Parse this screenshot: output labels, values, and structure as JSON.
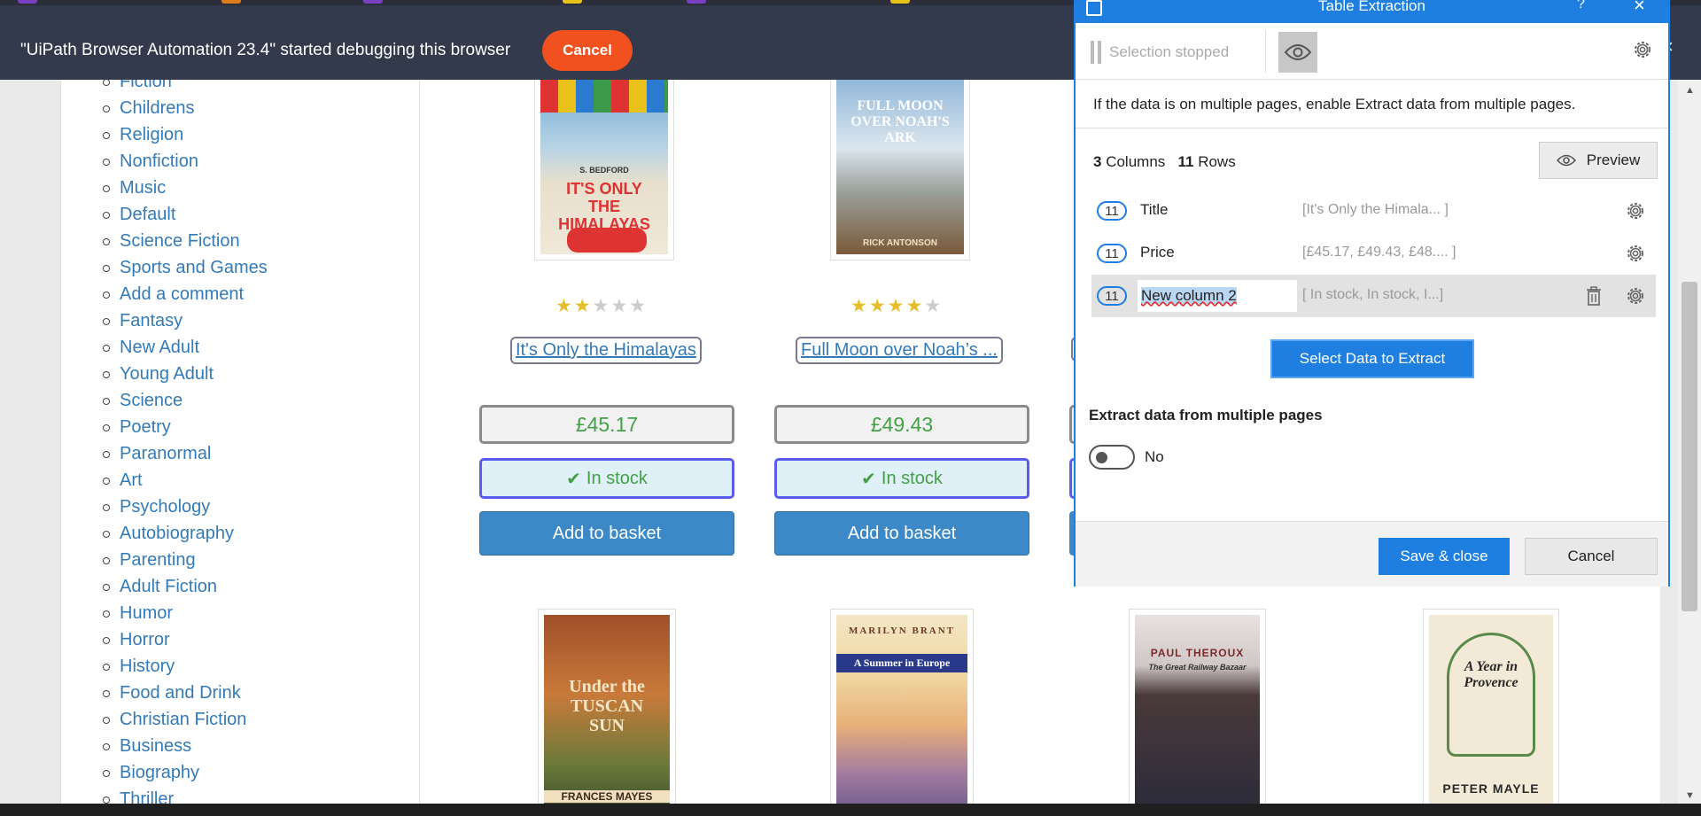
{
  "tabs": {
    "colors": [
      "#7b3fc4",
      "#e07b1a",
      "#7b3fc4",
      "#e8c21a",
      "#7b3fc4",
      "#e8c21a"
    ]
  },
  "debug_bar": {
    "message": "\"UiPath Browser Automation 23.4\" started debugging this browser",
    "cancel_label": "Cancel",
    "close_icon": "×"
  },
  "sidebar": {
    "partial_top": "Fiction",
    "categories": [
      "Childrens",
      "Religion",
      "Nonfiction",
      "Music",
      "Default",
      "Science Fiction",
      "Sports and Games",
      "Add a comment",
      "Fantasy",
      "New Adult",
      "Young Adult",
      "Science",
      "Poetry",
      "Paranormal",
      "Art",
      "Psychology",
      "Autobiography",
      "Parenting",
      "Adult Fiction",
      "Humor",
      "Horror",
      "History",
      "Food and Drink",
      "Christian Fiction",
      "Business",
      "Biography",
      "Thriller"
    ]
  },
  "products": [
    {
      "title": "It's Only the Himalayas",
      "price": "£45.17",
      "availability": "In stock",
      "rating": 2,
      "basket_label": "Add to basket",
      "cover": {
        "author": "S. BEDFORD",
        "title": "IT'S ONLY THE HIMALAYAS"
      }
    },
    {
      "title": "Full Moon over Noah’s ...",
      "price": "£49.43",
      "availability": "In stock",
      "rating": 4,
      "basket_label": "Add to basket",
      "cover": {
        "title": "FULL MOON OVER NOAH'S ARK",
        "author": "RICK ANTONSON"
      }
    }
  ],
  "lower_covers": [
    {
      "title": "Under the TUSCAN SUN",
      "author": "FRANCES MAYES"
    },
    {
      "title": "A Summer in Europe",
      "author": "MARILYN BRANT"
    },
    {
      "title": "The Great Railway Bazaar",
      "author": "PAUL THEROUX"
    },
    {
      "title": "A Year in Provence",
      "author": "PETER MAYLE"
    }
  ],
  "dialog": {
    "title": "Table Extraction",
    "help_icon": "?",
    "close_icon": "×",
    "selection_status": "Selection stopped",
    "info_text": "If the data is on multiple pages, enable Extract data from multiple pages.",
    "columns_count": "3",
    "columns_label": "Columns",
    "rows_count": "11",
    "rows_label": "Rows",
    "preview_label": "Preview",
    "columns": [
      {
        "count": "11",
        "name": "Title",
        "preview": "[It's Only the Himala... ]"
      },
      {
        "count": "11",
        "name": "Price",
        "preview": "[£45.17, £49.43, £48.... ]"
      },
      {
        "count": "11",
        "name": "New column 2",
        "preview": "[ In stock,  In stock,  I...]"
      }
    ],
    "select_data_label": "Select Data to Extract",
    "multi_pages_label": "Extract data from multiple pages",
    "toggle_value": "No",
    "save_label": "Save & close",
    "cancel_label": "Cancel"
  }
}
